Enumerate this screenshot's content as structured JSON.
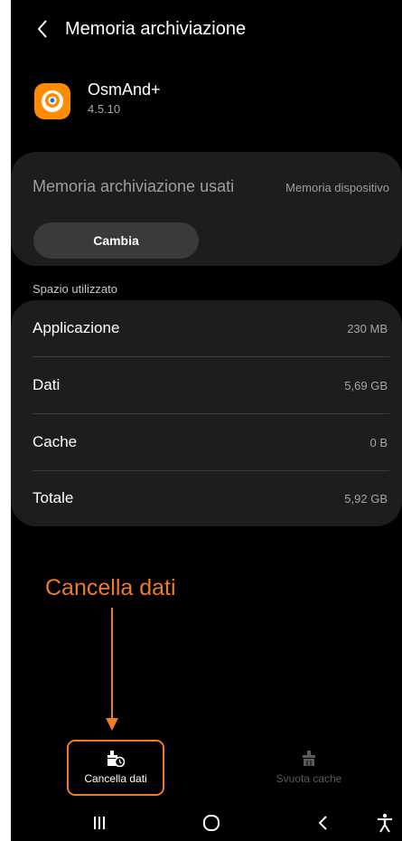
{
  "header": {
    "title": "Memoria archiviazione"
  },
  "app": {
    "name": "OsmAnd+",
    "version": "4.5.10",
    "icon": "osmand-app-icon",
    "icon_color": "#ff8c00"
  },
  "storage": {
    "label": "Memoria archiviazione usati",
    "value": "Memoria dispositivo",
    "change_label": "Cambia"
  },
  "usage": {
    "section_label": "Spazio utilizzato",
    "rows": [
      {
        "label": "Applicazione",
        "value": "230 MB"
      },
      {
        "label": "Dati",
        "value": "5,69 GB"
      },
      {
        "label": "Cache",
        "value": "0 B"
      },
      {
        "label": "Totale",
        "value": "5,92 GB"
      }
    ]
  },
  "annotation": {
    "text": "Cancella dati",
    "color": "#f07a2a"
  },
  "actions": {
    "clear_data_label": "Cancella dati",
    "clear_cache_label": "Svuota cache"
  },
  "navbar": {
    "icons": [
      "recent-apps-icon",
      "home-icon",
      "back-icon",
      "accessibility-icon"
    ]
  }
}
